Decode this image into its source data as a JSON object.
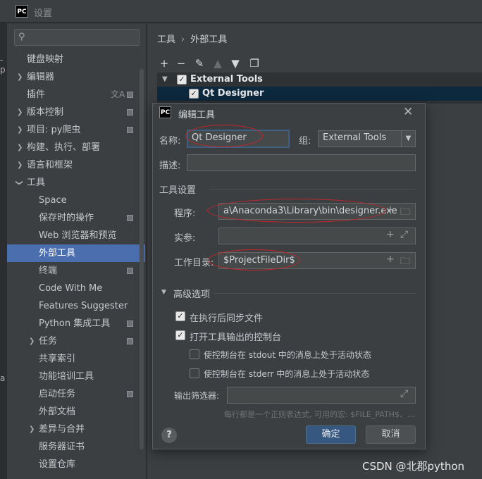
{
  "window": {
    "app_icon": "PC",
    "title": "设置"
  },
  "left_strip": {
    "labels": [
      "-p",
      "a"
    ]
  },
  "search": {
    "placeholder": ""
  },
  "sidebar": {
    "items": [
      {
        "label": "键盘映射"
      },
      {
        "label": "编辑器"
      },
      {
        "label": "插件"
      },
      {
        "label": "版本控制"
      },
      {
        "label": "项目: py爬虫"
      },
      {
        "label": "构建、执行、部署"
      },
      {
        "label": "语言和框架"
      },
      {
        "label": "工具"
      },
      {
        "label": "Space"
      },
      {
        "label": "保存时的操作"
      },
      {
        "label": "Web 浏览器和预览"
      },
      {
        "label": "外部工具"
      },
      {
        "label": "终端"
      },
      {
        "label": "Code With Me"
      },
      {
        "label": "Features Suggester"
      },
      {
        "label": "Python 集成工具"
      },
      {
        "label": "任务"
      },
      {
        "label": "共享索引"
      },
      {
        "label": "功能培训工具"
      },
      {
        "label": "启动任务"
      },
      {
        "label": "外部文档"
      },
      {
        "label": "差异与合并"
      },
      {
        "label": "服务器证书"
      },
      {
        "label": "设置仓库"
      }
    ]
  },
  "breadcrumb": {
    "parent": "工具",
    "separator": "›",
    "current": "外部工具"
  },
  "tool_list": {
    "group": "External Tools",
    "item": "Qt Designer"
  },
  "dialog": {
    "icon": "PC",
    "title": "编辑工具",
    "name_label": "名称:",
    "name_value": "Qt Designer",
    "group_label": "组:",
    "group_value": "External Tools",
    "desc_label": "描述:",
    "desc_value": "",
    "tool_settings_label": "工具设置",
    "program_label": "程序:",
    "program_value": "a\\Anaconda3\\Library\\bin\\designer.exe",
    "args_label": "实参:",
    "args_value": "",
    "workdir_label": "工作目录:",
    "workdir_value": "$ProjectFileDir$",
    "advanced_label": "高级选项",
    "sync_files_label": "在执行后同步文件",
    "sync_files_checked": true,
    "open_console_label": "打开工具输出的控制台",
    "open_console_checked": true,
    "stdout_label": "使控制台在 stdout 中的消息上处于活动状态",
    "stdout_checked": false,
    "stderr_label": "使控制台在 stderr 中的消息上处于活动状态",
    "stderr_checked": false,
    "output_filter_label": "输出筛选器:",
    "output_filter_value": "",
    "hint": "每行都是一个正则表达式, 可用的宏: $FILE_PATH$、...",
    "ok_label": "确定",
    "cancel_label": "取消",
    "help_label": "?"
  },
  "watermark": "CSDN @北郡python",
  "colors": {
    "selection": "#4b6eaf",
    "ok_button": "#365880",
    "annotation": "#c7262a"
  }
}
